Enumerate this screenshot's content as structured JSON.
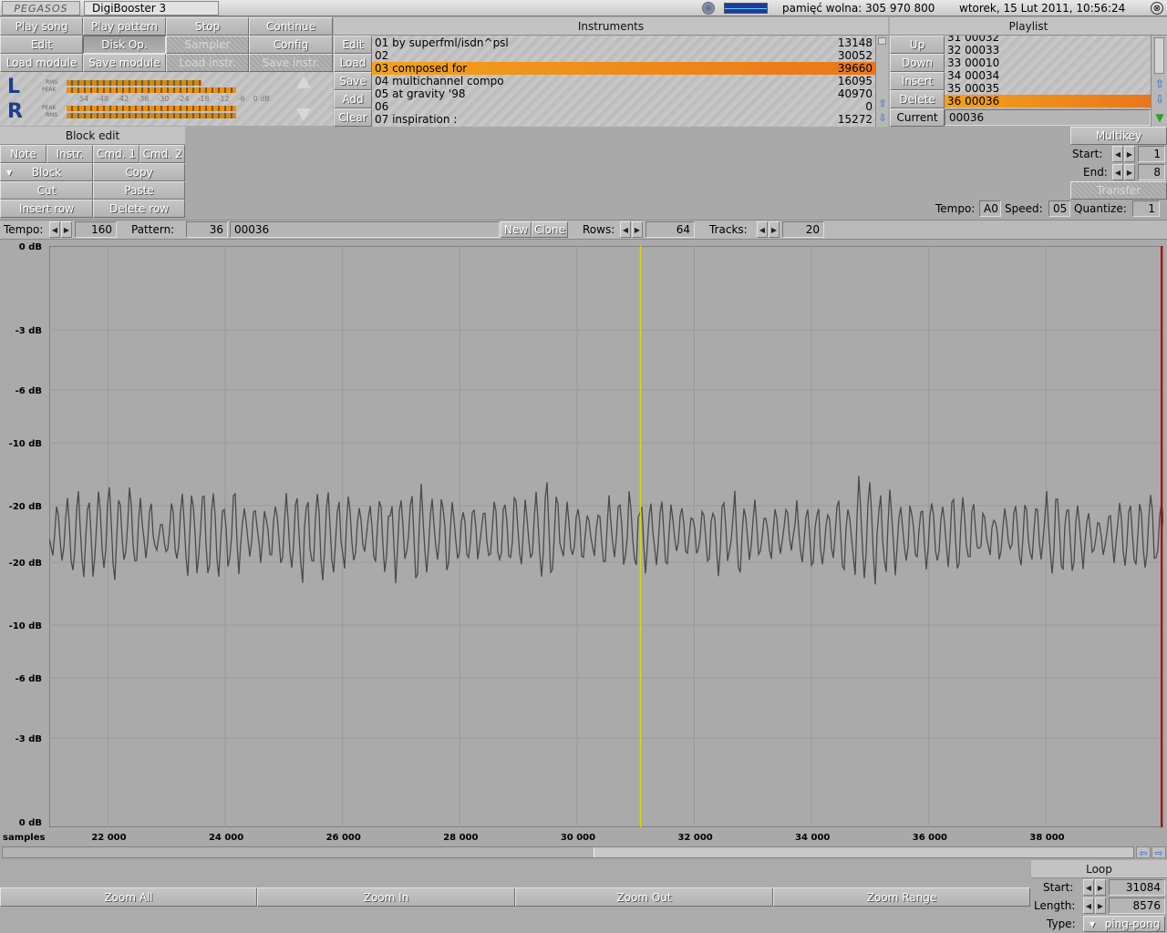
{
  "topbar": {
    "logo": "PEGASOS",
    "app_title": "DigiBooster 3",
    "memory": "pamięć wolna: 305 970 800",
    "datetime": "wtorek, 15 Lut 2011, 10:56:24"
  },
  "transport": {
    "row1": [
      "Play song",
      "Play pattern",
      "Stop",
      "Continue"
    ],
    "row2": [
      "Edit",
      "Disk Op.",
      "Sampler",
      "Config"
    ],
    "row3": [
      "Load module",
      "Save module",
      "Load instr.",
      "Save instr."
    ]
  },
  "meters": {
    "left_label": "L",
    "right_label": "R",
    "rms": "RMS",
    "peak": "PEAK",
    "scale": [
      "-54",
      "-48",
      "-42",
      "-36",
      "-30",
      "-24",
      "-18",
      "-12",
      "-6",
      "0 dB"
    ],
    "left_level": 0.62,
    "left_peak": 0.78,
    "right_level": 0.78,
    "right_peak": 0.78
  },
  "instruments": {
    "title": "Instruments",
    "buttons": [
      "Edit",
      "Load",
      "Save",
      "Add",
      "Clear"
    ],
    "rows": [
      {
        "name": "01 by superfml/isdn^psl",
        "size": "13148"
      },
      {
        "name": "02",
        "size": "30052"
      },
      {
        "name": "03 composed for",
        "size": "39660"
      },
      {
        "name": "04 multichannel compo",
        "size": "16095"
      },
      {
        "name": "05 at gravity '98",
        "size": "40970"
      },
      {
        "name": "06",
        "size": "0"
      },
      {
        "name": "07 inspiration :",
        "size": "15272"
      }
    ],
    "selected_index": 2
  },
  "playlist": {
    "title": "Playlist",
    "buttons": [
      "Up",
      "Down",
      "Insert",
      "Delete"
    ],
    "current_label": "Current",
    "current_value": "00036",
    "rows": [
      "31 00032",
      "32 00033",
      "33 00010",
      "34 00034",
      "35 00035",
      "36 00036"
    ],
    "selected_index": 5
  },
  "block_edit": {
    "title": "Block edit",
    "row1": [
      "Note",
      "Instr.",
      "Cmd. 1",
      "Cmd. 2"
    ],
    "block": "Block",
    "copy": "Copy",
    "cut": "Cut",
    "paste": "Paste",
    "insert_row": "Insert row",
    "delete_row": "Delete row"
  },
  "multikey": {
    "title": "Multikey",
    "start_label": "Start:",
    "start_value": "1",
    "end_label": "End:",
    "end_value": "8",
    "transfer": "Transfer"
  },
  "tempo_row": {
    "tempo_label": "Tempo:",
    "tempo_value": "A0",
    "speed_label": "Speed:",
    "speed_value": "05",
    "quantize_label": "Quantize:",
    "quantize_value": "1"
  },
  "pattern_bar": {
    "tempo_label": "Tempo:",
    "tempo_value": "160",
    "pattern_label": "Pattern:",
    "pattern_num": "36",
    "pattern_name": "00036",
    "new": "New",
    "clone": "Clone",
    "rows_label": "Rows:",
    "rows_value": "64",
    "tracks_label": "Tracks:",
    "tracks_value": "20"
  },
  "waveform": {
    "db_labels": [
      "0 dB",
      "-3 dB",
      "-6 dB",
      "-10 dB",
      "-20 dB",
      "-20 dB",
      "-10 dB",
      "-6 dB",
      "-3 dB",
      "0 dB"
    ],
    "x_unit": "samples",
    "x_ticks": [
      "22 000",
      "24 000",
      "26 000",
      "28 000",
      "30 000",
      "32 000",
      "34 000",
      "36 000",
      "38 000"
    ],
    "cursor_sample": 31084,
    "range_start": 21000,
    "range_end": 40000,
    "colors": {
      "bg": "#aaaaaa",
      "wave": "#4a4a4a",
      "grid": "#9a9a9a",
      "cursor": "#d8d800",
      "end_marker": "#b00000"
    }
  },
  "zoom": [
    "Zoom All",
    "Zoom In",
    "Zoom Out",
    "Zoom Range"
  ],
  "loop": {
    "title": "Loop",
    "start_label": "Start:",
    "start_value": "31084",
    "length_label": "Length:",
    "length_value": "8576",
    "type_label": "Type:",
    "type_value": "ping-pong"
  }
}
